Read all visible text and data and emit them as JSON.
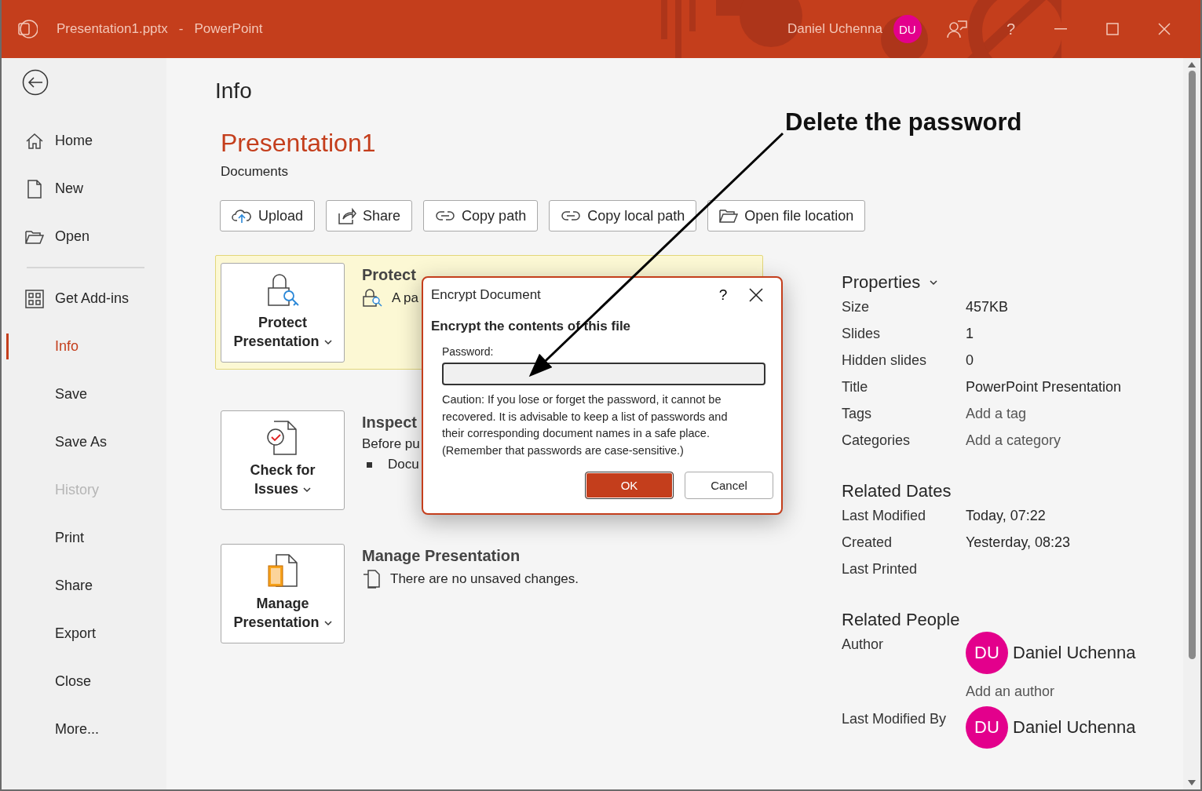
{
  "window": {
    "file": "Presentation1.pptx",
    "separator": "-",
    "app": "PowerPoint",
    "user": "Daniel Uchenna",
    "initials": "DU",
    "help": "?"
  },
  "sidebar": {
    "items": [
      {
        "label": "Home",
        "selected": false,
        "disabled": false,
        "divider_after": false
      },
      {
        "label": "New",
        "selected": false,
        "disabled": false,
        "divider_after": false
      },
      {
        "label": "Open",
        "selected": false,
        "disabled": false,
        "divider_after": true
      },
      {
        "label": "Get Add-ins",
        "selected": false,
        "disabled": false,
        "divider_after": false
      },
      {
        "label": "Info",
        "selected": true,
        "disabled": false,
        "divider_after": false
      },
      {
        "label": "Save",
        "selected": false,
        "disabled": false,
        "divider_after": false
      },
      {
        "label": "Save As",
        "selected": false,
        "disabled": false,
        "divider_after": false
      },
      {
        "label": "History",
        "selected": false,
        "disabled": true,
        "divider_after": false
      },
      {
        "label": "Print",
        "selected": false,
        "disabled": false,
        "divider_after": false
      },
      {
        "label": "Share",
        "selected": false,
        "disabled": false,
        "divider_after": false
      },
      {
        "label": "Export",
        "selected": false,
        "disabled": false,
        "divider_after": false
      },
      {
        "label": "Close",
        "selected": false,
        "disabled": false,
        "divider_after": false
      },
      {
        "label": "More...",
        "selected": false,
        "disabled": false,
        "divider_after": false
      }
    ]
  },
  "info": {
    "heading": "Info",
    "file_name": "Presentation1",
    "location": "Documents",
    "actions": [
      {
        "label": "Upload"
      },
      {
        "label": "Share"
      },
      {
        "label": "Copy path"
      },
      {
        "label": "Copy local path"
      },
      {
        "label": "Open file location"
      }
    ]
  },
  "sections": [
    {
      "button": "Protect Presentation",
      "highlighted": true,
      "heading": "Protect",
      "lines": [
        {
          "kind": "icon",
          "text": "A pa"
        }
      ]
    },
    {
      "button": "Check for Issues",
      "highlighted": false,
      "heading": "Inspect",
      "lines": [
        {
          "kind": "plain",
          "text": "Before pu"
        },
        {
          "kind": "bullet",
          "text": "Docu"
        }
      ]
    },
    {
      "button": "Manage Presentation",
      "highlighted": false,
      "heading": "Manage Presentation",
      "lines": [
        {
          "kind": "icon",
          "text": "There are no unsaved changes."
        }
      ]
    }
  ],
  "properties": [
    {
      "title": "Properties",
      "dropdown": true,
      "rows": [
        {
          "label": "Size",
          "kind": "text",
          "value": "457KB"
        },
        {
          "label": "Slides",
          "kind": "text",
          "value": "1"
        },
        {
          "label": "Hidden slides",
          "kind": "text",
          "value": "0"
        },
        {
          "label": "Title",
          "kind": "text",
          "value": "PowerPoint Presentation"
        },
        {
          "label": "Tags",
          "kind": "link",
          "value": "Add a tag"
        },
        {
          "label": "Categories",
          "kind": "link",
          "value": "Add a category"
        }
      ]
    },
    {
      "title": "Related Dates",
      "dropdown": false,
      "rows": [
        {
          "label": "Last Modified",
          "kind": "text",
          "value": "Today, 07:22"
        },
        {
          "label": "Created",
          "kind": "text",
          "value": "Yesterday, 08:23"
        },
        {
          "label": "Last Printed",
          "kind": "text"
        }
      ]
    },
    {
      "title": "Related People",
      "dropdown": false,
      "rows": [
        {
          "label": "Author",
          "kind": "person",
          "initials": "DU",
          "value": "Daniel Uchenna",
          "add": "Add an author"
        },
        {
          "label": "Last Modified By",
          "kind": "person",
          "initials": "DU",
          "value": "Daniel Uchenna"
        }
      ]
    }
  ],
  "dialog": {
    "title": "Encrypt Document",
    "help": "?",
    "heading": "Encrypt the contents of this file",
    "field_label": "Password:",
    "caution": "Caution: If you lose or forget the password, it cannot be recovered. It is advisable to keep a list of passwords and their corresponding document names in a safe place. (Remember that passwords are case-sensitive.)",
    "buttons": [
      {
        "label": "OK",
        "kind": "primary"
      },
      {
        "label": "Cancel",
        "kind": "secondary"
      }
    ]
  },
  "annotation": {
    "text": "Delete the password"
  }
}
